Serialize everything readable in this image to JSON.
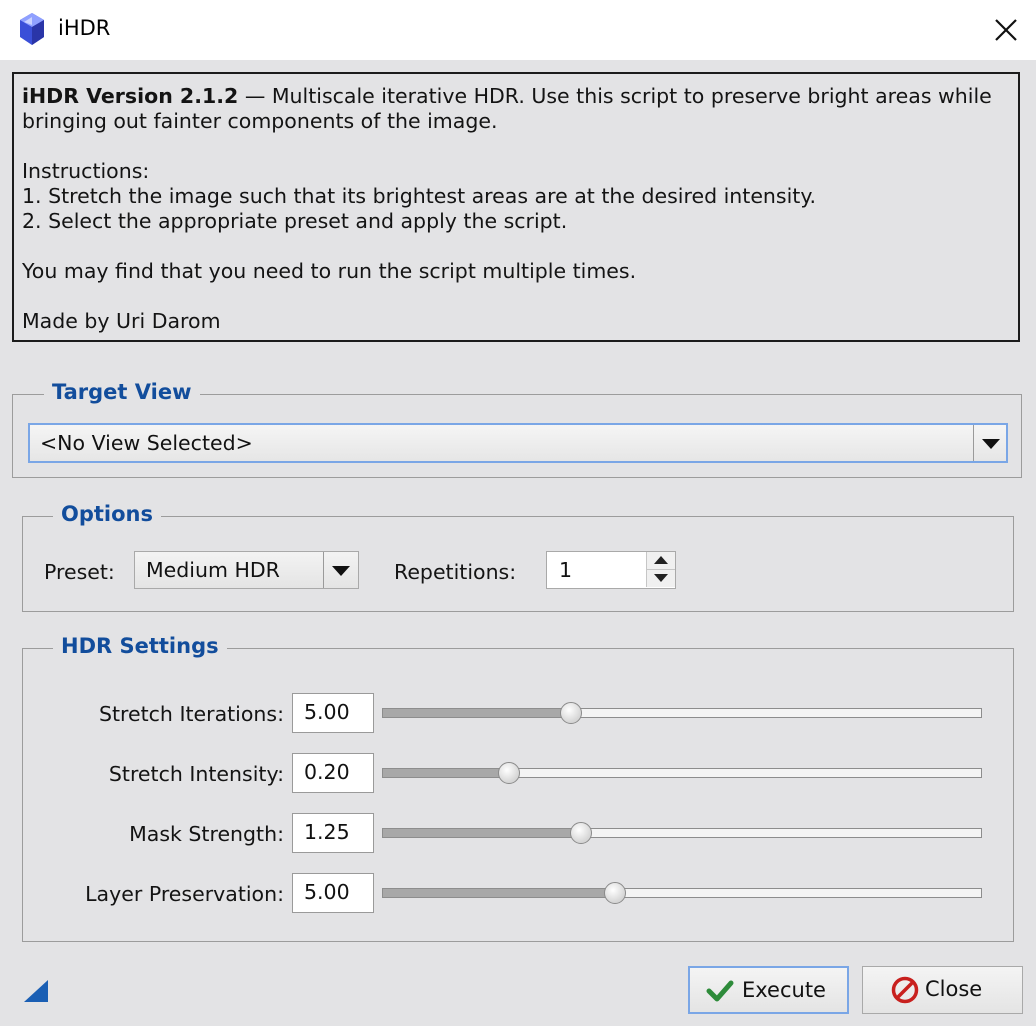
{
  "window": {
    "title": "iHDR",
    "icon": "blue-crystal-icon",
    "close_icon": "close-icon"
  },
  "description": {
    "version_bold": "iHDR Version 2.1.2",
    "intro_rest": " — Multiscale iterative HDR. Use this script to preserve bright areas while bringing out fainter components of the image.",
    "instructions_heading": "Instructions:",
    "step1": "1. Stretch the image such that its brightest areas are at the desired intensity.",
    "step2": "2. Select the appropriate preset and apply the script.",
    "note": "You may find that you need to run the script multiple times.",
    "author": "Made by Uri Darom"
  },
  "target_view": {
    "title": "Target View",
    "selected": "<No View Selected>"
  },
  "options": {
    "title": "Options",
    "preset_label": "Preset:",
    "preset_value": "Medium HDR",
    "repetitions_label": "Repetitions:",
    "repetitions_value": "1"
  },
  "hdr_settings": {
    "title": "HDR Settings",
    "rows": [
      {
        "label": "Stretch Iterations:",
        "value": "5.00",
        "slider_fraction": 0.315
      },
      {
        "label": "Stretch Intensity:",
        "value": "0.20",
        "slider_fraction": 0.212
      },
      {
        "label": "Mask Strength:",
        "value": "1.25",
        "slider_fraction": 0.332
      },
      {
        "label": "Layer Preservation:",
        "value": "5.00",
        "slider_fraction": 0.388
      }
    ]
  },
  "buttons": {
    "execute_label": "Execute",
    "execute_icon": "checkmark-icon",
    "close_label": "Close",
    "close_icon": "no-entry-icon"
  },
  "colors": {
    "group_title": "#124d9c",
    "focus_border": "#7aa6e6",
    "execute_check": "#2e8b3a",
    "close_icon": "#c8201e",
    "corner_mark": "#1a5fb4"
  }
}
